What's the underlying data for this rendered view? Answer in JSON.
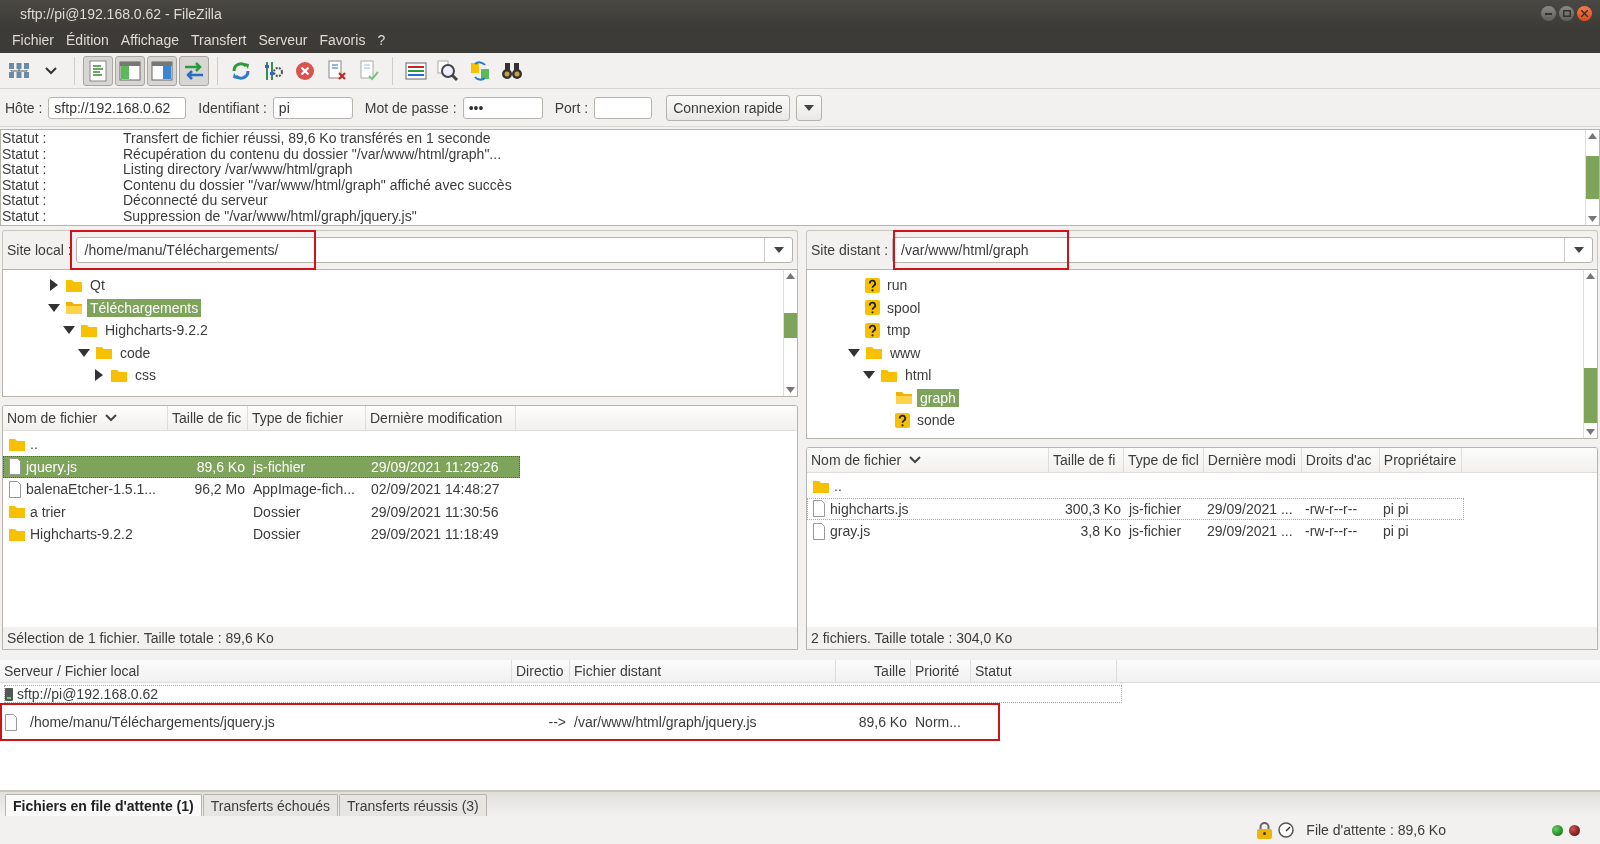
{
  "window": {
    "title": "sftp://pi@192.168.0.62 - FileZilla"
  },
  "menu": [
    "Fichier",
    "Édition",
    "Affichage",
    "Transfert",
    "Serveur",
    "Favoris",
    "?"
  ],
  "toolbar": [
    {
      "kind": "site-manager"
    },
    {
      "kind": "dropdown"
    },
    {
      "kind": "log",
      "on": true
    },
    {
      "kind": "local-tree",
      "on": true
    },
    {
      "kind": "remote-tree",
      "on": true
    },
    {
      "kind": "queue",
      "on": true
    },
    {
      "kind": "refresh"
    },
    {
      "kind": "filters"
    },
    {
      "kind": "cancel"
    },
    {
      "kind": "disconnect"
    },
    {
      "kind": "reconnect"
    },
    {
      "kind": "filter-list"
    },
    {
      "kind": "compare"
    },
    {
      "kind": "sync"
    },
    {
      "kind": "search"
    }
  ],
  "quickconnect": {
    "host_label": "Hôte :",
    "host": "sftp://192.168.0.62",
    "user_label": "Identifiant :",
    "user": "pi",
    "password_label": "Mot de passe :",
    "password": "•••",
    "port_label": "Port :",
    "button": "Connexion rapide"
  },
  "log": [
    {
      "label": "Statut :",
      "message": "Transfert de fichier réussi, 89,6 Ko transférés en 1 seconde"
    },
    {
      "label": "Statut :",
      "message": "Récupération du contenu du dossier \"/var/www/html/graph\"..."
    },
    {
      "label": "Statut :",
      "message": "Listing directory /var/www/html/graph"
    },
    {
      "label": "Statut :",
      "message": "Contenu du dossier \"/var/www/html/graph\" affiché avec succès"
    },
    {
      "label": "Statut :",
      "message": "Déconnecté du serveur"
    },
    {
      "label": "Statut :",
      "message": "Suppression de \"/var/www/html/graph/jquery.js\""
    }
  ],
  "local": {
    "label": "Site local :",
    "path": "/home/manu/Téléchargements/",
    "highlighted": true,
    "tree": [
      {
        "name": "Qt",
        "kind": "folder",
        "expanded": false,
        "selected": false
      },
      {
        "name": "Téléchargements",
        "kind": "folder",
        "expanded": true,
        "selected": true,
        "children": [
          {
            "name": "Highcharts-9.2.2",
            "kind": "folder",
            "expanded": true,
            "selected": false,
            "children": [
              {
                "name": "code",
                "kind": "folder",
                "expanded": true,
                "selected": false,
                "children": [
                  {
                    "name": "css",
                    "kind": "folder",
                    "expanded": false,
                    "selected": false
                  }
                ]
              }
            ]
          }
        ]
      }
    ],
    "columns": [
      {
        "label": "Nom de fichier",
        "sorted": true
      },
      {
        "label": "Taille de fic",
        "sorted": false
      },
      {
        "label": "Type de fichier",
        "sorted": false
      },
      {
        "label": "Dernière modification",
        "sorted": false
      }
    ],
    "rows": [
      {
        "kind": "folder",
        "cells": [
          ".."
        ],
        "selected": false
      },
      {
        "kind": "file",
        "cells": [
          "jquery.js",
          "89,6 Ko",
          "js-fichier",
          "29/09/2021 11:29:26"
        ],
        "selected": true
      },
      {
        "kind": "file",
        "cells": [
          "balenaEtcher-1.5.1...",
          "96,2 Mo",
          "AppImage-fich...",
          "02/09/2021 14:48:27"
        ],
        "selected": false
      },
      {
        "kind": "folder",
        "cells": [
          "a trier",
          "",
          "Dossier",
          "29/09/2021 11:30:56"
        ],
        "selected": false
      },
      {
        "kind": "folder",
        "cells": [
          "Highcharts-9.2.2",
          "",
          "Dossier",
          "29/09/2021 11:18:49"
        ],
        "selected": false
      }
    ],
    "status": "Sélection de 1 fichier. Taille totale : 89,6 Ko"
  },
  "remote": {
    "label": "Site distant :",
    "path": "/var/www/html/graph",
    "highlighted": true,
    "tree": [
      {
        "name": "run",
        "kind": "unknown",
        "selected": false
      },
      {
        "name": "spool",
        "kind": "unknown",
        "selected": false
      },
      {
        "name": "tmp",
        "kind": "unknown",
        "selected": false
      },
      {
        "name": "www",
        "kind": "folder",
        "expanded": true,
        "selected": false,
        "children": [
          {
            "name": "html",
            "kind": "folder",
            "expanded": true,
            "selected": false,
            "children": [
              {
                "name": "graph",
                "kind": "folder",
                "selected": true
              },
              {
                "name": "sonde",
                "kind": "unknown",
                "selected": false
              }
            ]
          }
        ]
      }
    ],
    "columns": [
      {
        "label": "Nom de fichier",
        "sorted": true
      },
      {
        "label": "Taille de fi",
        "sorted": false
      },
      {
        "label": "Type de ficl",
        "sorted": false
      },
      {
        "label": "Dernière modi",
        "sorted": false
      },
      {
        "label": "Droits d'ac",
        "sorted": false
      },
      {
        "label": "Propriétaire",
        "sorted": false
      }
    ],
    "rows": [
      {
        "kind": "folder",
        "cells": [
          ".."
        ],
        "selected": false,
        "focused": false
      },
      {
        "kind": "file",
        "cells": [
          "highcharts.js",
          "300,3 Ko",
          "js-fichier",
          "29/09/2021 ...",
          "-rw-r--r--",
          "pi pi"
        ],
        "selected": false,
        "focused": true
      },
      {
        "kind": "file",
        "cells": [
          "gray.js",
          "3,8 Ko",
          "js-fichier",
          "29/09/2021 ...",
          "-rw-r--r--",
          "pi pi"
        ],
        "selected": false,
        "focused": false
      }
    ],
    "status": "2 fichiers. Taille totale : 304,0 Ko"
  },
  "queue": {
    "columns": [
      "Serveur / Fichier local",
      "Directio",
      "Fichier distant",
      "Taille",
      "Priorité",
      "Statut"
    ],
    "server": "sftp://pi@192.168.0.62",
    "items": [
      {
        "local": "/home/manu/Téléchargements/jquery.js",
        "direction": "-->",
        "remote": "/var/www/html/graph/jquery.js",
        "size": "89,6 Ko",
        "priority": "Norm...",
        "highlighted": true
      }
    ]
  },
  "tabs": [
    {
      "label": "Fichiers en file d'attente (1)",
      "selected": true
    },
    {
      "label": "Transferts échoués",
      "selected": false
    },
    {
      "label": "Transferts réussis (3)",
      "selected": false
    }
  ],
  "status_bar": {
    "queue": "File d'attente : 89,6 Ko"
  }
}
